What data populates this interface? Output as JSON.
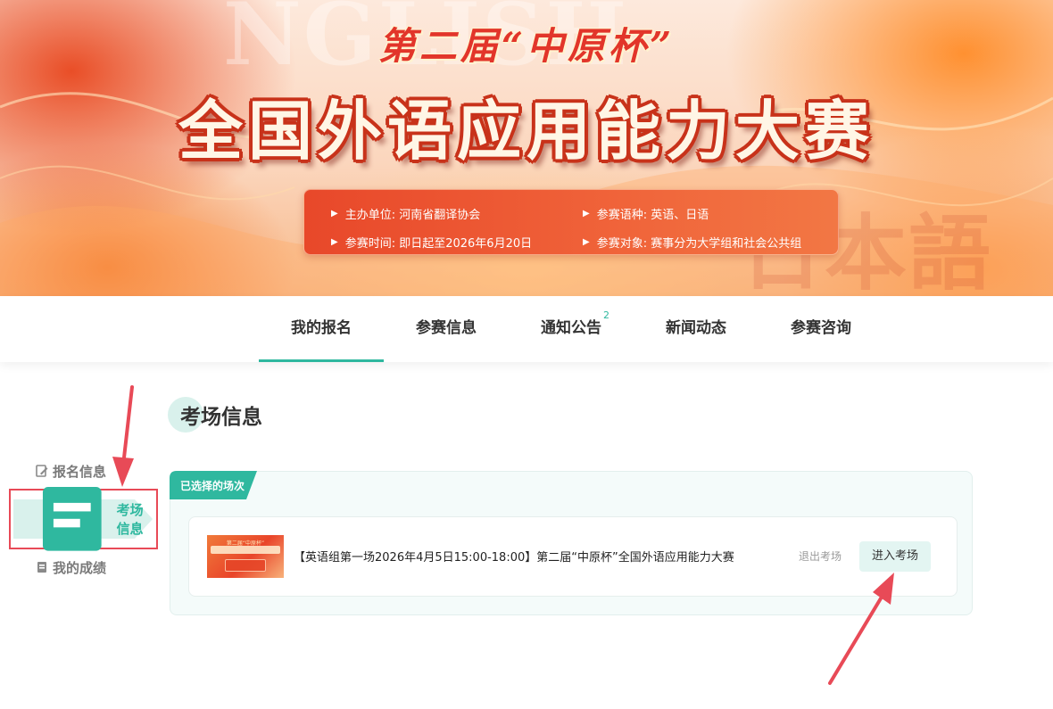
{
  "banner": {
    "bg_word_top": "NGLISH",
    "bg_word_right": "日本語",
    "sub_title": "第二届“中原杯”",
    "main_title": "全国外语应用能力大赛",
    "info": [
      {
        "label": "主办单位: 河南省翻译协会"
      },
      {
        "label": "参赛语种: 英语、日语"
      },
      {
        "label": "参赛时间: 即日起至2026年6月20日"
      },
      {
        "label": "参赛对象: 赛事分为大学组和社会公共组"
      }
    ]
  },
  "nav": {
    "items": [
      {
        "label": "我的报名",
        "active": true
      },
      {
        "label": "参赛信息"
      },
      {
        "label": "通知公告",
        "badge": "2"
      },
      {
        "label": "新闻动态"
      },
      {
        "label": "参赛咨询"
      }
    ]
  },
  "sidebar": {
    "items": [
      {
        "label": "报名信息",
        "icon": "edit-icon"
      },
      {
        "label": "考场信息",
        "icon": "exam-icon",
        "active": true
      },
      {
        "label": "我的成绩",
        "icon": "score-icon"
      }
    ]
  },
  "content": {
    "section_title": "考场信息",
    "panel_chip": "已选择的场次",
    "session": {
      "thumb_caption": "第二届“中原杯”",
      "title": "【英语组第一场2026年4月5日15:00-18:00】第二届“中原杯”全国外语应用能力大赛",
      "exit_label": "退出考场",
      "enter_label": "进入考场"
    }
  },
  "colors": {
    "accent": "#2fb89f",
    "highlight_box": "#e84a57",
    "arrow": "#e84a57"
  }
}
